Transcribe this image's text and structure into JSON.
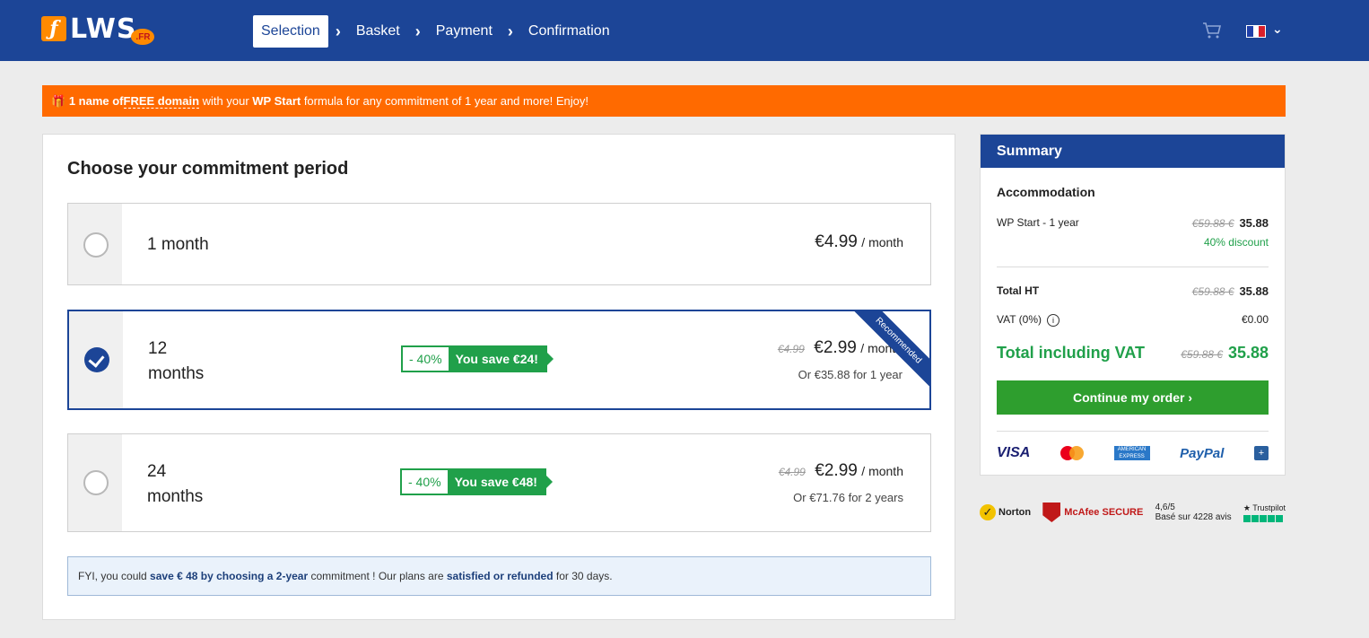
{
  "header": {
    "logo_text": "LWS",
    "logo_badge": ".FR",
    "steps": [
      "Selection",
      "Basket",
      "Payment",
      "Confirmation"
    ],
    "active_step": 0,
    "colors": {
      "bar": "#1c4597",
      "accent": "#ff8a00"
    }
  },
  "promo": {
    "gift_icon": "🎁",
    "p1": "1 name of",
    "p2": "FREE domain",
    "p3": " with your ",
    "p4": "WP Start",
    "p5": " formula for any commitment of 1 year and more! Enjoy!",
    "color": "#ff6a00"
  },
  "main": {
    "title": "Choose your commitment period",
    "options": [
      {
        "label": "1 month",
        "price": "€4.99",
        "unit": "/ month",
        "selected": false
      },
      {
        "label1": "12",
        "label2": "months",
        "discount": "- 40%",
        "save": "You save €24!",
        "old_price": "€4.99",
        "price": "€2.99",
        "unit": "/ month",
        "sub": "Or €35.88 for 1 year",
        "ribbon": "Recommended",
        "selected": true
      },
      {
        "label1": "24",
        "label2": "months",
        "discount": "- 40%",
        "save": "You save €48!",
        "old_price": "€4.99",
        "price": "€2.99",
        "unit": "/ month",
        "sub": "Or €71.76 for 2 years",
        "selected": false
      }
    ],
    "fyi": {
      "a": "FYI, you could ",
      "b": "save € 48 by choosing a 2-year",
      "c": " commitment ! Our plans are ",
      "d": "satisfied or refunded",
      "e": " for 30 days."
    }
  },
  "summary": {
    "title": "Summary",
    "section": "Accommodation",
    "item": {
      "label": "WP Start - 1 year",
      "old": "€59.88 €",
      "value": "35.88",
      "discount": "40% discount"
    },
    "total_ht": {
      "label": "Total HT",
      "old": "€59.88 €",
      "value": "35.88"
    },
    "vat": {
      "label": "VAT (0%)",
      "value": "€0.00"
    },
    "total": {
      "label": "Total including VAT",
      "old": "€59.88 €",
      "value": "35.88"
    },
    "continue_label": "Continue my order  ›",
    "payments": {
      "visa": "VISA",
      "amex": "AMERICAN EXPRESS",
      "paypal": "PayPal",
      "other": "+"
    }
  },
  "trust": {
    "norton": "Norton",
    "mcafee": "McAfee SECURE",
    "score": "4,6/5",
    "reviews": "Basé sur 4228 avis",
    "trustpilot": "★ Trustpilot"
  }
}
